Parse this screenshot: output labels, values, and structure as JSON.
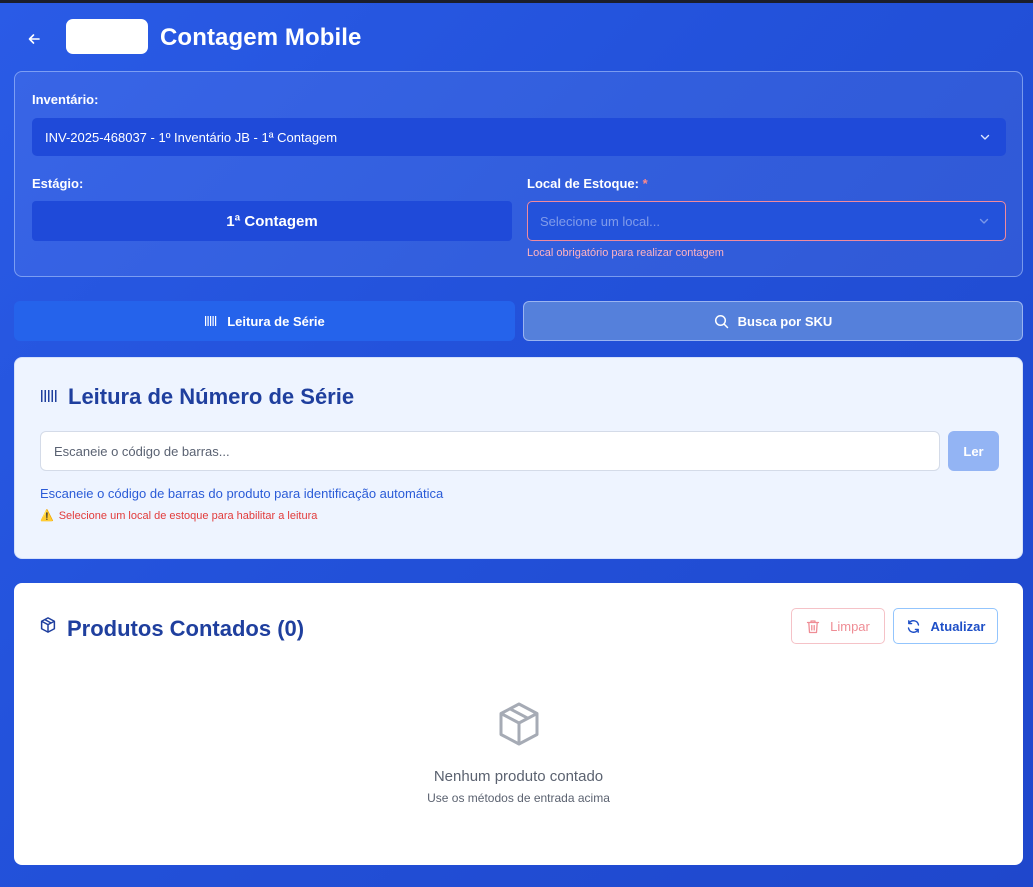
{
  "header": {
    "title": "Contagem Mobile",
    "back_icon": "arrow-left-icon"
  },
  "config": {
    "inventory_label": "Inventário:",
    "inventory_value": "INV-2025-468037 - 1º Inventário JB - 1ª Contagem",
    "stage_label": "Estágio:",
    "stage_value": "1ª Contagem",
    "local_label": "Local de Estoque:",
    "local_required_mark": "*",
    "local_placeholder": "Selecione um local...",
    "local_error": "Local obrigatório para realizar contagem"
  },
  "modes": {
    "serial_label": "Leitura de Série",
    "sku_label": "Busca por SKU",
    "active": "serial"
  },
  "serial_reader": {
    "title": "Leitura de Número de Série",
    "input_placeholder": "Escaneie o código de barras...",
    "read_button": "Ler",
    "help_text": "Escaneie o código de barras do produto para identificação automática",
    "warning_text": "Selecione um local de estoque para habilitar a leitura",
    "warning_icon": "⚠️"
  },
  "products": {
    "title": "Produtos Contados (0)",
    "clear_button": "Limpar",
    "refresh_button": "Atualizar",
    "empty_title": "Nenhum produto contado",
    "empty_subtitle": "Use os métodos de entrada acima"
  },
  "colors": {
    "background": "#2352db",
    "primary": "#2563eb",
    "title_blue": "#1f3f9e",
    "error": "#e23b3b"
  }
}
